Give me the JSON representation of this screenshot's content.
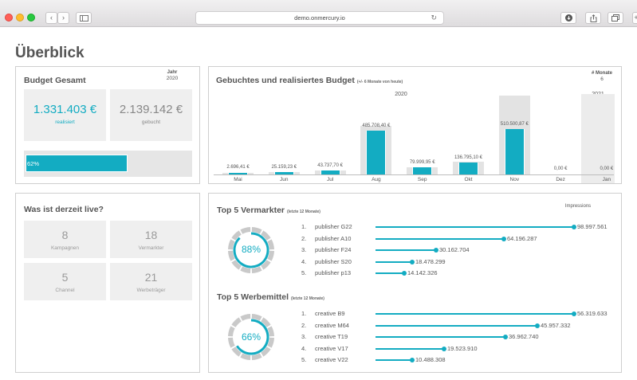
{
  "browser": {
    "url": "demo.onmercury.io",
    "reload_glyph": "↻"
  },
  "page_title": "Überblick",
  "budget": {
    "title": "Budget Gesamt",
    "year_label": "Jahr",
    "year_value": "2020",
    "realized_value": "1.331.403 €",
    "realized_label": "realisiert",
    "booked_value": "2.139.142 €",
    "booked_label": "gebucht",
    "progress_text": "62%",
    "progress_fraction": 0.62
  },
  "booked_chart": {
    "title": "Gebuchtes und realisiertes Budget",
    "subtitle": "(+/- 6 Monate von heute)",
    "months_label": "# Monate",
    "months_value": "6",
    "year_2020": "2020",
    "year_2021": "2021"
  },
  "chart_data": {
    "type": "bar",
    "categories": [
      "Mai",
      "Jun",
      "Jul",
      "Aug",
      "Sep",
      "Okt",
      "Nov",
      "Dez",
      "Jan"
    ],
    "series": [
      {
        "name": "gebucht",
        "values": [
          3000,
          30000,
          45000,
          540000,
          82000,
          140000,
          880000,
          0,
          0
        ]
      },
      {
        "name": "realisiert",
        "values": [
          2696.41,
          25159.23,
          43737.7,
          485708.4,
          79999.95,
          136795.1,
          510500.87,
          0,
          0
        ]
      }
    ],
    "data_labels": [
      "2.696,41 €",
      "25.159,23 €",
      "43.737,70 €",
      "485.708,40 €",
      "79.999,95 €",
      "136.795,10 €",
      "510.500,87 €",
      "0,00 €",
      "0,00 €"
    ],
    "ylim": [
      0,
      900000
    ],
    "grid": false
  },
  "live": {
    "title": "Was ist derzeit live?",
    "stats": [
      {
        "value": "8",
        "label": "Kampagnen"
      },
      {
        "value": "18",
        "label": "Vermarkter"
      },
      {
        "value": "5",
        "label": "Channel"
      },
      {
        "value": "21",
        "label": "Werbeträger"
      }
    ]
  },
  "top_vermarkter": {
    "title": "Top 5 Vermarkter",
    "subtitle": "(letzte 12 Monate)",
    "impressions_label": "Impressions",
    "gauge_text": "88%",
    "gauge_fraction": 0.88,
    "items": [
      {
        "idx": "1.",
        "name": "publisher G22",
        "value": "98.997.561",
        "amount": 98997561
      },
      {
        "idx": "2.",
        "name": "publisher A10",
        "value": "64.196.287",
        "amount": 64196287
      },
      {
        "idx": "3.",
        "name": "publisher F24",
        "value": "30.162.704",
        "amount": 30162704
      },
      {
        "idx": "4.",
        "name": "publisher S20",
        "value": "18.478.299",
        "amount": 18478299
      },
      {
        "idx": "5.",
        "name": "publisher p13",
        "value": "14.142.326",
        "amount": 14142326
      }
    ]
  },
  "top_werbemittel": {
    "title": "Top 5 Werbemittel",
    "subtitle": "(letzte 12 Monate)",
    "gauge_text": "66%",
    "gauge_fraction": 0.66,
    "items": [
      {
        "idx": "1.",
        "name": "creative B9",
        "value": "56.319.633",
        "amount": 56319633
      },
      {
        "idx": "2.",
        "name": "creative M64",
        "value": "45.957.332",
        "amount": 45957332
      },
      {
        "idx": "3.",
        "name": "creative T19",
        "value": "36.962.740",
        "amount": 36962740
      },
      {
        "idx": "4.",
        "name": "creative V17",
        "value": "19.523.910",
        "amount": 19523910
      },
      {
        "idx": "5.",
        "name": "creative V22",
        "value": "10.488.308",
        "amount": 10488308
      }
    ]
  },
  "colors": {
    "accent": "#13acc2",
    "track": "#e3e3e3"
  }
}
